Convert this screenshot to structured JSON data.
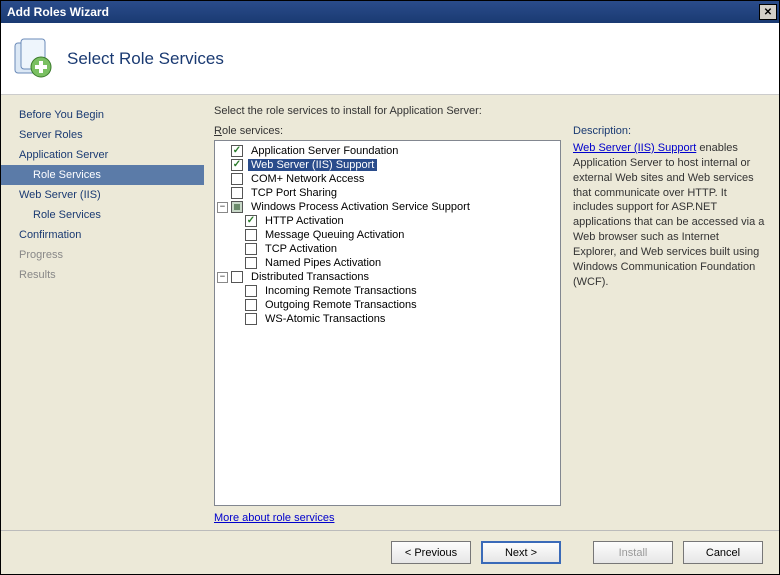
{
  "titlebar": {
    "title": "Add Roles Wizard",
    "close_aria": "Close"
  },
  "header": {
    "heading": "Select Role Services"
  },
  "sidebar": {
    "items": [
      {
        "label": "Before You Begin",
        "state": "normal"
      },
      {
        "label": "Server Roles",
        "state": "normal"
      },
      {
        "label": "Application Server",
        "state": "normal"
      },
      {
        "label": "Role Services",
        "state": "selected",
        "sub": true
      },
      {
        "label": "Web Server (IIS)",
        "state": "normal"
      },
      {
        "label": "Role Services",
        "state": "normal",
        "sub": true
      },
      {
        "label": "Confirmation",
        "state": "normal"
      },
      {
        "label": "Progress",
        "state": "disabled"
      },
      {
        "label": "Results",
        "state": "disabled"
      }
    ]
  },
  "main": {
    "instruction": "Select the role services to install for Application Server:",
    "role_services_label_pre": "R",
    "role_services_label_post": "ole services:",
    "more_link": "More about role services"
  },
  "tree": [
    {
      "level": 0,
      "twisty": "",
      "checked": "checked",
      "label": "Application Server Foundation"
    },
    {
      "level": 0,
      "twisty": "",
      "checked": "checked",
      "label": "Web Server (IIS) Support",
      "selected": true
    },
    {
      "level": 0,
      "twisty": "",
      "checked": "unchecked",
      "label": "COM+ Network Access"
    },
    {
      "level": 0,
      "twisty": "",
      "checked": "unchecked",
      "label": "TCP Port Sharing"
    },
    {
      "level": 0,
      "twisty": "minus",
      "checked": "mixed",
      "label": "Windows Process Activation Service Support"
    },
    {
      "level": 1,
      "twisty": "",
      "checked": "checked",
      "label": "HTTP Activation"
    },
    {
      "level": 1,
      "twisty": "",
      "checked": "unchecked",
      "label": "Message Queuing Activation"
    },
    {
      "level": 1,
      "twisty": "",
      "checked": "unchecked",
      "label": "TCP Activation"
    },
    {
      "level": 1,
      "twisty": "",
      "checked": "unchecked",
      "label": "Named Pipes Activation"
    },
    {
      "level": 0,
      "twisty": "minus",
      "checked": "unchecked",
      "label": "Distributed Transactions"
    },
    {
      "level": 1,
      "twisty": "",
      "checked": "unchecked",
      "label": "Incoming Remote Transactions"
    },
    {
      "level": 1,
      "twisty": "",
      "checked": "unchecked",
      "label": "Outgoing Remote Transactions"
    },
    {
      "level": 1,
      "twisty": "",
      "checked": "unchecked",
      "label": "WS-Atomic Transactions"
    }
  ],
  "description": {
    "heading": "Description:",
    "link_text": "Web Server (IIS) Support",
    "body_rest": " enables Application Server to host internal or external Web sites and Web services that communicate over HTTP. It includes support for ASP.NET applications that can be accessed via a Web browser such as Internet Explorer, and Web services built using Windows Communication Foundation (WCF)."
  },
  "buttons": {
    "previous": "< Previous",
    "next": "Next >",
    "install": "Install",
    "cancel": "Cancel"
  }
}
